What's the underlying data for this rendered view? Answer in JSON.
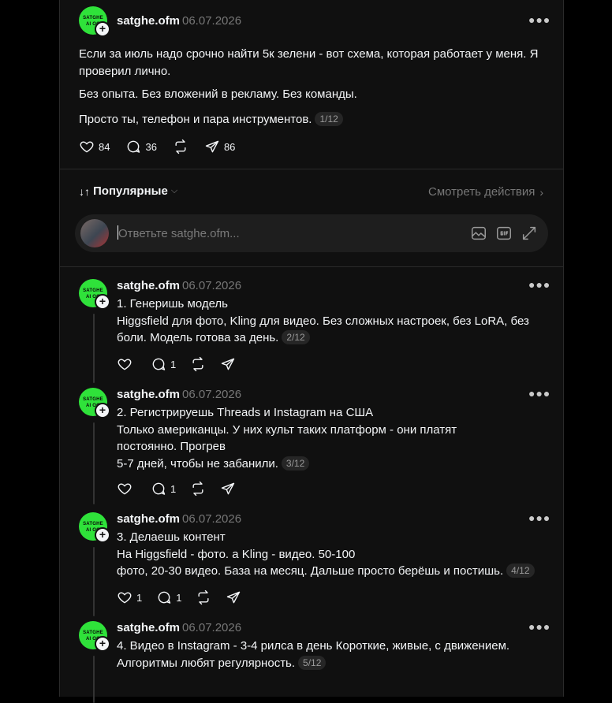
{
  "main_post": {
    "avatar_text": "SATGHE AI OO",
    "username": "satghe.ofm",
    "date": "06.07.2026",
    "paragraphs": [
      "Если за июль надо срочно найти 5к зелени - вот схема, которая работает у меня. Я проверил лично.",
      "Без опыта. Без вложений в рекламу. Без команды.",
      "Просто ты, телефон и пара инструментов."
    ],
    "pager": "1/12",
    "likes": "84",
    "comments": "36",
    "shares": "86"
  },
  "sort": {
    "label": "Популярные",
    "view_activity": "Смотреть действия"
  },
  "reply": {
    "placeholder": "Ответьте satghe.ofm..."
  },
  "replies": [
    {
      "avatar_text": "SATGHE AI OO",
      "username": "satghe.ofm",
      "date": "06.07.2026",
      "lines": [
        "1. Генеришь модель",
        "Higgsfield для фото, Kling для видео. Без сложных настроек, без LoRA, без",
        "боли. Модель готова за день."
      ],
      "pager": "2/12",
      "likes": "",
      "comments": "1"
    },
    {
      "avatar_text": "SATGHE AI OO",
      "username": "satghe.ofm",
      "date": "06.07.2026",
      "lines": [
        "2. Регистрируешь Threads и Instagram на США",
        "Только американцы. У них культ таких платформ - они платят",
        "постоянно. Прогрев",
        "5-7 дней, чтобы не забанили."
      ],
      "pager": "3/12",
      "likes": "",
      "comments": "1"
    },
    {
      "avatar_text": "SATGHE AI OO",
      "username": "satghe.ofm",
      "date": "06.07.2026",
      "lines": [
        "3. Делаешь контент",
        "На Higgsfield - фото. а Kling - видео. 50-100",
        "фото, 20-30 видео. База на месяц. Дальше просто берёшь и постишь."
      ],
      "pager": "4/12",
      "likes": "1",
      "comments": "1"
    },
    {
      "avatar_text": "SATGHE AI OO",
      "username": "satghe.ofm",
      "date": "06.07.2026",
      "lines": [
        "4. Видео в Instagram - 3-4 рилса в день Короткие, живые, с движением.",
        "Алгоритмы любят регулярность."
      ],
      "pager": "5/12",
      "likes": "",
      "comments": ""
    }
  ],
  "icons": {
    "like": "heart-icon",
    "comment": "comment-icon",
    "repost": "repost-icon",
    "share": "share-icon",
    "more": "more-icon",
    "image": "image-icon",
    "gif": "gif-icon",
    "expand": "expand-icon"
  },
  "colors": {
    "background": "#000000",
    "card": "#101010",
    "avatar_green": "#2fe23a",
    "muted_text": "#777777"
  }
}
